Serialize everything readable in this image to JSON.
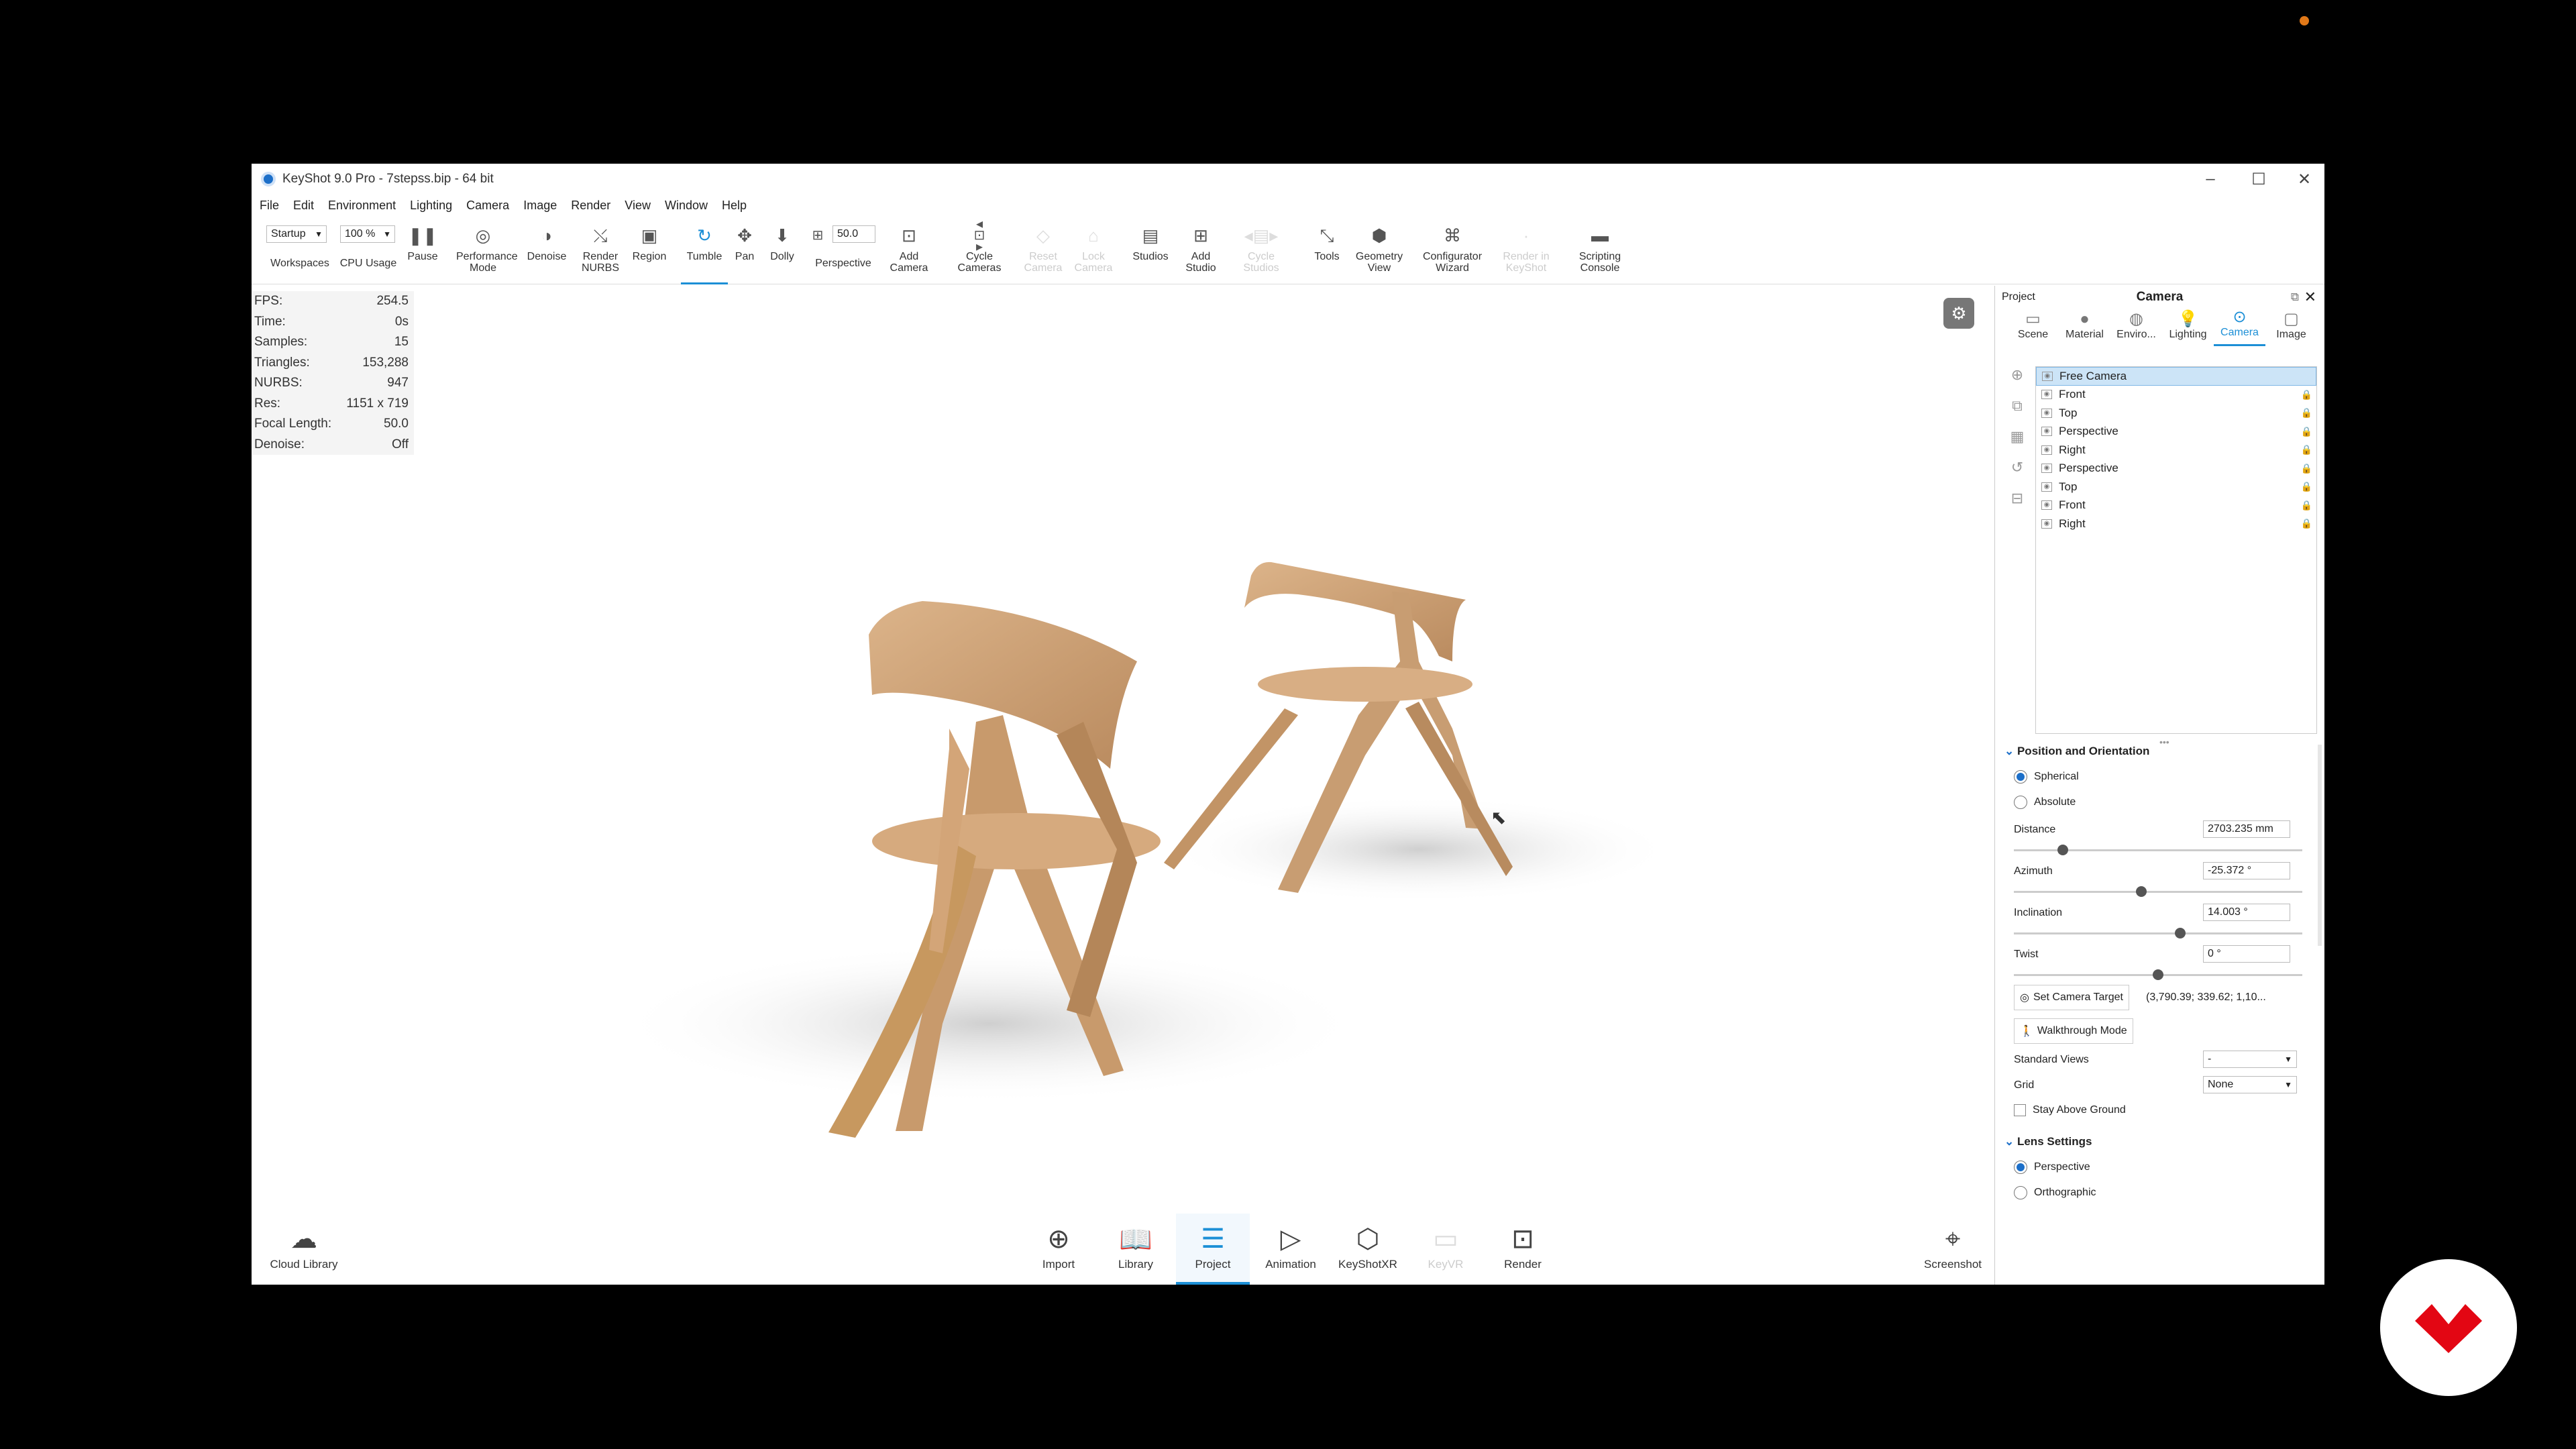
{
  "window": {
    "title": "KeyShot 9.0 Pro - 7stepss.bip - 64 bit"
  },
  "menu": [
    "File",
    "Edit",
    "Environment",
    "Lighting",
    "Camera",
    "Image",
    "Render",
    "View",
    "Window",
    "Help"
  ],
  "toolbar": {
    "workspace_value": "Startup",
    "cpu_value": "100 %",
    "focal_value": "50.0",
    "labels": {
      "workspaces": "Workspaces",
      "cpu": "CPU Usage",
      "pause": "Pause",
      "performance": "Performance Mode",
      "denoise": "Denoise",
      "render_nurbs": "Render NURBS",
      "region": "Region",
      "tumble": "Tumble",
      "pan": "Pan",
      "dolly": "Dolly",
      "perspective": "Perspective",
      "add_camera": "Add Camera",
      "cycle_cameras": "Cycle Cameras",
      "reset_camera": "Reset Camera",
      "lock_camera": "Lock Camera",
      "studios": "Studios",
      "add_studio": "Add Studio",
      "cycle_studios": "Cycle Studios",
      "tools": "Tools",
      "geometry_view": "Geometry View",
      "configurator": "Configurator Wizard",
      "render_keyshot": "Render in KeyShot",
      "scripting": "Scripting Console"
    }
  },
  "hud": [
    {
      "label": "FPS:",
      "value": "254.5"
    },
    {
      "label": "Time:",
      "value": "0s"
    },
    {
      "label": "Samples:",
      "value": "15"
    },
    {
      "label": "Triangles:",
      "value": "153,288"
    },
    {
      "label": "NURBS:",
      "value": "947"
    },
    {
      "label": "Res:",
      "value": "1151 x 719"
    },
    {
      "label": "Focal Length:",
      "value": "50.0"
    },
    {
      "label": "Denoise:",
      "value": "Off"
    }
  ],
  "bottom": {
    "cloud": "Cloud Library",
    "import": "Import",
    "library": "Library",
    "project": "Project",
    "animation": "Animation",
    "keyshotxr": "KeyShotXR",
    "keyvr": "KeyVR",
    "render": "Render",
    "screenshot": "Screenshot"
  },
  "panel": {
    "project_label": "Project",
    "title": "Camera",
    "tabs": [
      "Scene",
      "Material",
      "Enviro...",
      "Lighting",
      "Camera",
      "Image"
    ],
    "cameras": [
      "Free Camera",
      "Front",
      "Top",
      "Perspective",
      "Right",
      "Perspective",
      "Top",
      "Front",
      "Right"
    ],
    "position_section": "Position and Orientation",
    "spherical": "Spherical",
    "absolute": "Absolute",
    "distance_label": "Distance",
    "distance_value": "2703.235 mm",
    "azimuth_label": "Azimuth",
    "azimuth_value": "-25.372 °",
    "inclination_label": "Inclination",
    "inclination_value": "14.003 °",
    "twist_label": "Twist",
    "twist_value": "0 °",
    "set_target": "Set Camera Target",
    "target_value": "(3,790.39; 339.62; 1,10...",
    "walkthrough": "Walkthrough Mode",
    "standard_views_label": "Standard Views",
    "standard_views_value": "-",
    "grid_label": "Grid",
    "grid_value": "None",
    "stay_above": "Stay Above Ground",
    "lens_section": "Lens Settings",
    "perspective": "Perspective",
    "orthographic": "Orthographic"
  },
  "colors": {
    "accent": "#1c8fd6",
    "wood": "#d2a77c",
    "brand_red": "#e30613"
  }
}
